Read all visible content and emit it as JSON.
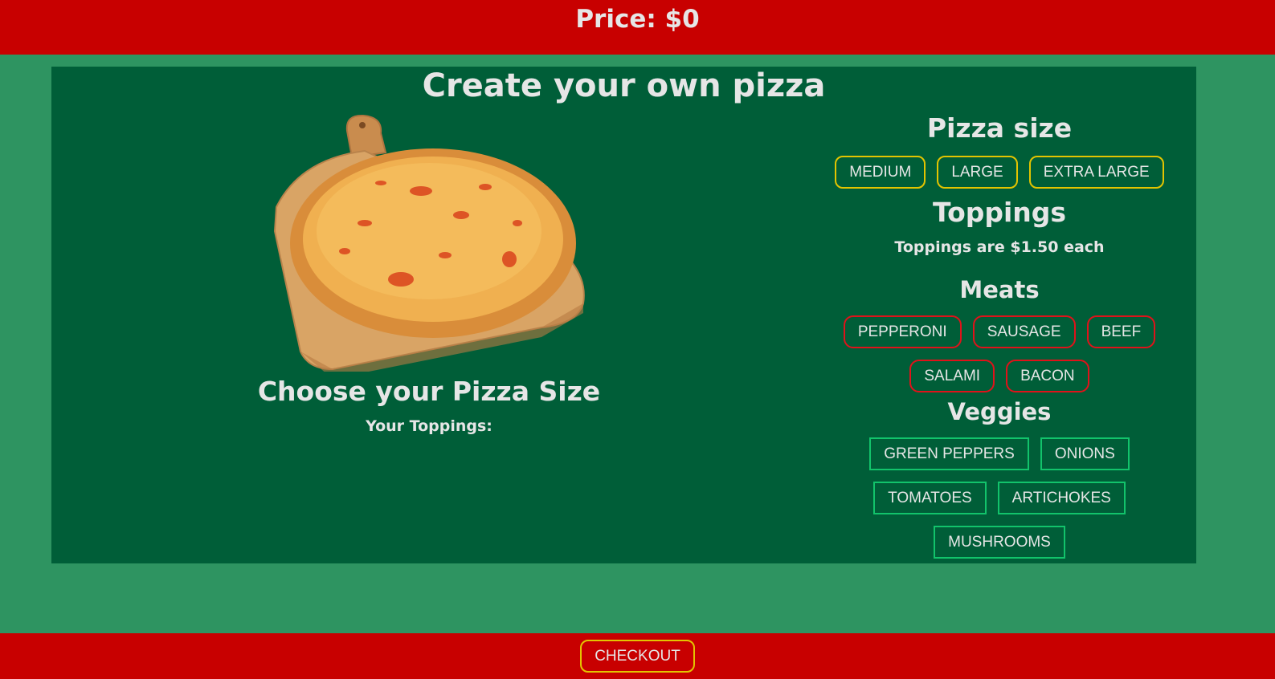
{
  "header": {
    "price_text": "Price: $0"
  },
  "main": {
    "title": "Create your own pizza",
    "choose_label": "Choose your Pizza Size",
    "your_toppings_label": "Your Toppings:"
  },
  "options": {
    "size_heading": "Pizza size",
    "sizes": [
      "MEDIUM",
      "LARGE",
      "EXTRA LARGE"
    ],
    "toppings_heading": "Toppings",
    "toppings_note": "Toppings are $1.50 each",
    "meats_heading": "Meats",
    "meats": [
      "PEPPERONI",
      "SAUSAGE",
      "BEEF",
      "SALAMI",
      "BACON"
    ],
    "veggies_heading": "Veggies",
    "veggies": [
      "GREEN PEPPERS",
      "ONIONS",
      "TOMATOES",
      "ARTICHOKES",
      "MUSHROOMS"
    ]
  },
  "footer": {
    "checkout_label": "CHECKOUT"
  },
  "colors": {
    "bar": "#c80000",
    "page_bg": "#2e9461",
    "panel_bg": "#005e38",
    "size_border": "#e3c400",
    "meat_border": "#e0121a",
    "veg_border": "#12c36b"
  }
}
